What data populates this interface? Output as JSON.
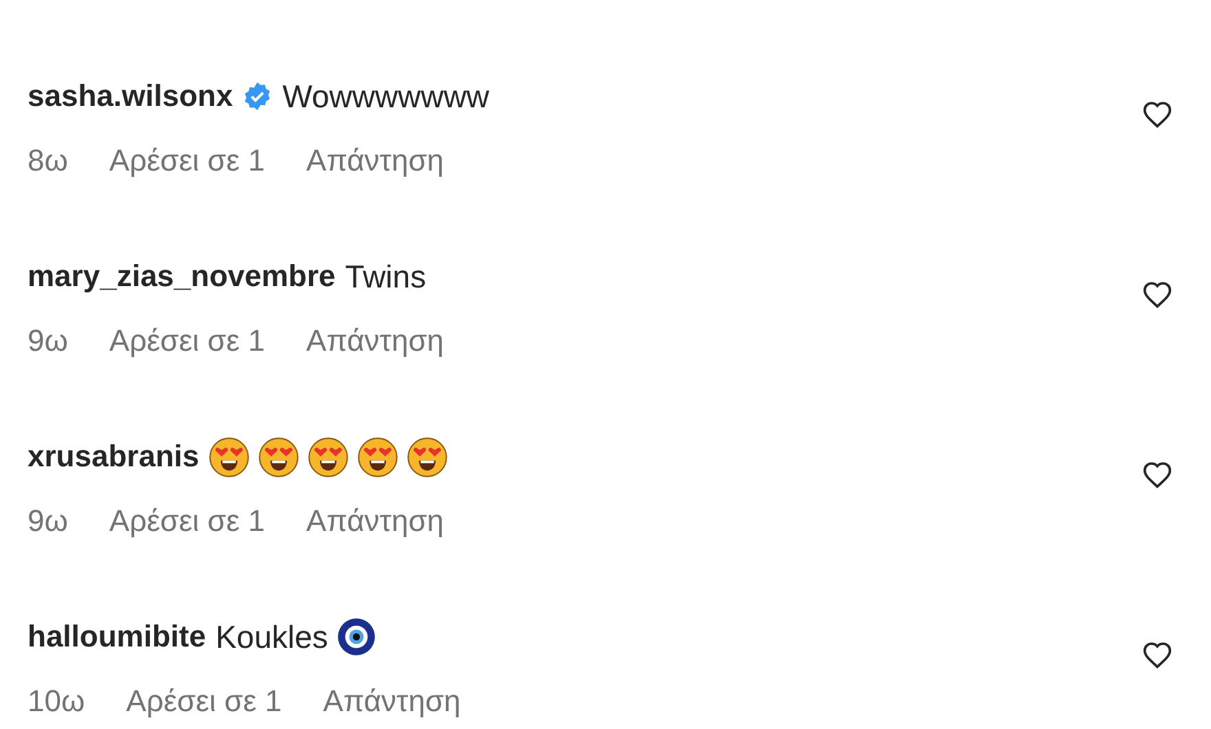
{
  "comments": [
    {
      "username": "sasha.wilsonx",
      "verified": true,
      "text": "Wowwwwwww",
      "time": "8ω",
      "likes": "Αρέσει σε 1",
      "reply": "Απάντηση",
      "liked": false
    },
    {
      "username": "mary_zias_novembre",
      "verified": false,
      "text": "Twins",
      "time": "9ω",
      "likes": "Αρέσει σε 1",
      "reply": "Απάντηση",
      "liked": false
    },
    {
      "username": "xrusabranis",
      "verified": false,
      "emojis": [
        {
          "kind": "heart_eyes"
        },
        {
          "kind": "heart_eyes"
        },
        {
          "kind": "heart_eyes"
        },
        {
          "kind": "heart_eyes"
        },
        {
          "kind": "heart_eyes"
        }
      ],
      "time": "9ω",
      "likes": "Αρέσει σε 1",
      "reply": "Απάντηση",
      "liked": false
    },
    {
      "username": "halloumibite",
      "verified": false,
      "text": "Koukles",
      "emojis": [
        {
          "kind": "nazar"
        }
      ],
      "time": "10ω",
      "likes": "Αρέσει σε 1",
      "reply": "Απάντηση",
      "liked": false
    }
  ]
}
